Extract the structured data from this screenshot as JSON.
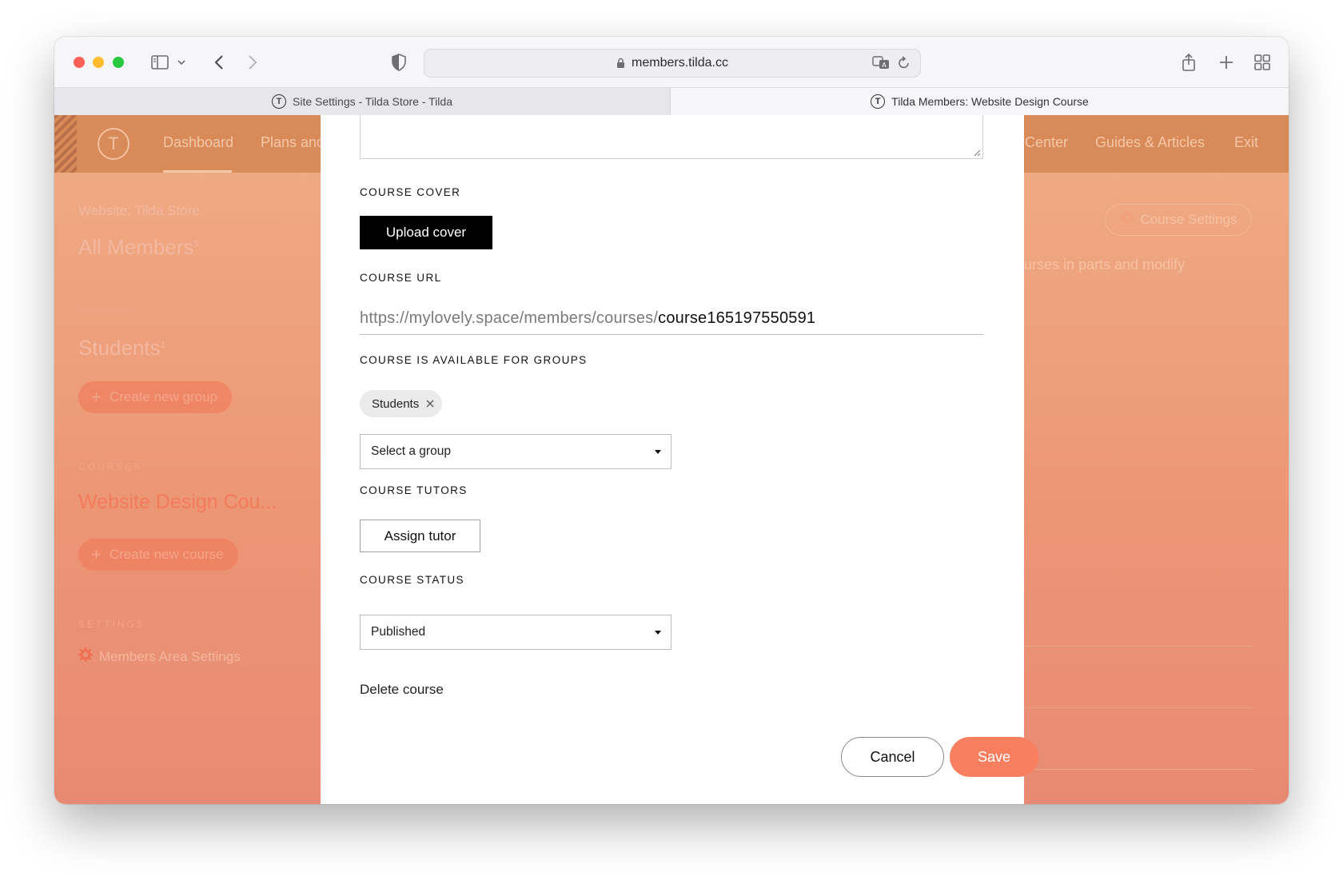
{
  "browser": {
    "address": "members.tilda.cc",
    "tabs": [
      {
        "label": "Site Settings - Tilda Store - Tilda"
      },
      {
        "label": "Tilda Members: Website Design Course"
      }
    ]
  },
  "nav": {
    "logo": "T",
    "dashboard": "Dashboard",
    "plans": "Plans and",
    "center": "Center",
    "guides": "Guides & Articles",
    "exit": "Exit"
  },
  "sidebar": {
    "website": "Website: Tilda Store",
    "all_members": "All Members",
    "all_members_count": "5",
    "groups_heading": "GROUPS",
    "group_name": "Students",
    "group_count": "1",
    "create_group": "Create new group",
    "courses_heading": "COURSES",
    "course_name": "Website Design Cou...",
    "create_course": "Create new course",
    "settings_heading": "SETTINGS",
    "members_settings": "Members Area Settings"
  },
  "right_panel": {
    "course_settings": "Course Settings",
    "text_fragment": "urses in parts and modify"
  },
  "modal": {
    "cover_label": "COURSE COVER",
    "upload_button": "Upload cover",
    "url_label": "COURSE URL",
    "url_prefix": "https://mylovely.space/members/courses/",
    "url_slug": "course165197550591",
    "groups_label": "COURSE IS AVAILABLE FOR GROUPS",
    "group_chip": "Students",
    "group_select": "Select a group",
    "tutors_label": "COURSE TUTORS",
    "assign_button": "Assign tutor",
    "status_label": "COURSE STATUS",
    "status_value": "Published",
    "delete_link": "Delete course",
    "cancel_button": "Cancel",
    "save_button": "Save"
  },
  "colors": {
    "accent": "#f77f5f",
    "nav_bg": "#d98a59"
  }
}
